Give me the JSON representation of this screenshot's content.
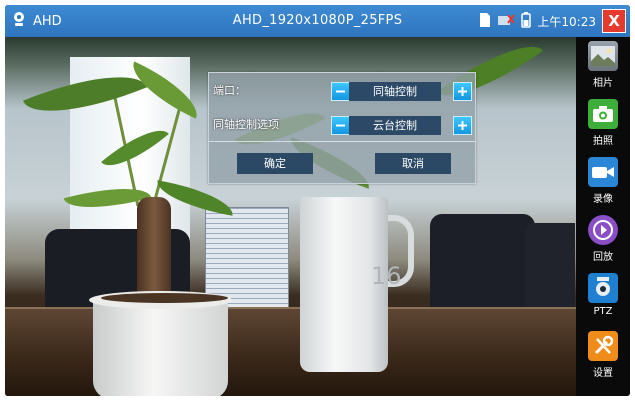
{
  "titlebar": {
    "app_name": "AHD",
    "title": "AHD_1920x1080P_25FPS",
    "time": "上午10:23",
    "close_symbol": "X"
  },
  "dialog": {
    "port_label": "端口：",
    "port_value": "同轴控制",
    "coax_label": "同轴控制选项",
    "coax_value": "云台控制",
    "ok_label": "确定",
    "cancel_label": "取消"
  },
  "video_overlay": {
    "cup_number": "16"
  },
  "sidebar": {
    "items": [
      {
        "label": "相片",
        "icon": "photo-album-icon",
        "color": "#8a8f96"
      },
      {
        "label": "拍照",
        "icon": "camera-icon",
        "color": "#3dae3a"
      },
      {
        "label": "录像",
        "icon": "video-camera-icon",
        "color": "#2b86d6"
      },
      {
        "label": "回放",
        "icon": "play-icon",
        "color": "#8a4fc7"
      },
      {
        "label": "PTZ",
        "icon": "ptz-camera-icon",
        "color": "#1f7fd0"
      },
      {
        "label": "设置",
        "icon": "tools-icon",
        "color": "#f08c1a"
      }
    ]
  }
}
